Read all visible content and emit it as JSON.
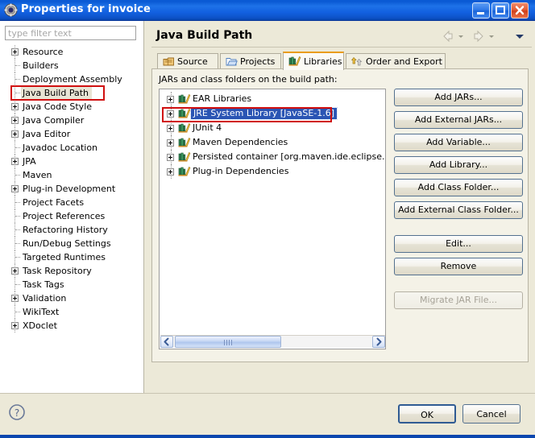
{
  "window": {
    "title": "Properties for invoice",
    "icon": "gear-icon",
    "controls": {
      "minimize": "Minimize",
      "maximize": "Maximize",
      "close": "Close"
    }
  },
  "colors": {
    "titlebar_blue": "#0a5ad4",
    "accent_orange": "#e99c1b",
    "selection_blue": "#2a55b4",
    "annotation_red": "#d01010",
    "dialog_bg": "#ece9d8",
    "group_bg": "#f4f2e7"
  },
  "sidebar": {
    "filter": {
      "value": "",
      "placeholder": "type filter text"
    },
    "items": [
      {
        "label": "Resource",
        "expandable": true
      },
      {
        "label": "Builders",
        "expandable": false
      },
      {
        "label": "Deployment Assembly",
        "expandable": false
      },
      {
        "label": "Java Build Path",
        "expandable": false,
        "selected": true,
        "annotated": true
      },
      {
        "label": "Java Code Style",
        "expandable": true
      },
      {
        "label": "Java Compiler",
        "expandable": true
      },
      {
        "label": "Java Editor",
        "expandable": true
      },
      {
        "label": "Javadoc Location",
        "expandable": false
      },
      {
        "label": "JPA",
        "expandable": true
      },
      {
        "label": "Maven",
        "expandable": false
      },
      {
        "label": "Plug-in Development",
        "expandable": true
      },
      {
        "label": "Project Facets",
        "expandable": false
      },
      {
        "label": "Project References",
        "expandable": false
      },
      {
        "label": "Refactoring History",
        "expandable": false
      },
      {
        "label": "Run/Debug Settings",
        "expandable": false
      },
      {
        "label": "Targeted Runtimes",
        "expandable": false
      },
      {
        "label": "Task Repository",
        "expandable": true
      },
      {
        "label": "Task Tags",
        "expandable": false
      },
      {
        "label": "Validation",
        "expandable": true
      },
      {
        "label": "WikiText",
        "expandable": false
      },
      {
        "label": "XDoclet",
        "expandable": true
      }
    ]
  },
  "page": {
    "title": "Java Build Path",
    "nav": {
      "back": "back-arrow-icon",
      "back_dropdown": "back-dropdown-caret",
      "forward": "forward-arrow-icon",
      "forward_dropdown": "forward-dropdown-caret",
      "menu": "view-menu-caret"
    },
    "tabs": [
      {
        "label": "Source",
        "icon": "package-icon",
        "active": false
      },
      {
        "label": "Projects",
        "icon": "folder-icon",
        "active": false
      },
      {
        "label": "Libraries",
        "icon": "library-books-icon",
        "active": true
      },
      {
        "label": "Order and Export",
        "icon": "order-arrows-icon",
        "active": false
      }
    ],
    "group_caption": "JARs and class folders on the build path:",
    "libraries": [
      {
        "label": "EAR Libraries",
        "icon": "library-books-icon",
        "expandable": true,
        "selected": false
      },
      {
        "label": "JRE System Library [JavaSE-1.6]",
        "icon": "library-books-icon",
        "expandable": true,
        "selected": true,
        "annotated": true
      },
      {
        "label": "JUnit 4",
        "icon": "library-books-icon",
        "expandable": true,
        "selected": false
      },
      {
        "label": "Maven Dependencies",
        "icon": "library-books-icon",
        "expandable": true,
        "selected": false
      },
      {
        "label": "Persisted container [org.maven.ide.eclipse.MAVEN",
        "icon": "library-books-icon",
        "expandable": true,
        "selected": false
      },
      {
        "label": "Plug-in Dependencies",
        "icon": "library-books-icon",
        "expandable": true,
        "selected": false
      }
    ],
    "scrollbar": {
      "left_arrow": "scroll-left-arrow-icon",
      "right_arrow": "scroll-right-arrow-icon",
      "thumb": "scroll-thumb"
    },
    "buttons": [
      {
        "label": "Add JARs...",
        "enabled": true
      },
      {
        "label": "Add External JARs...",
        "enabled": true
      },
      {
        "label": "Add Variable...",
        "enabled": true
      },
      {
        "label": "Add Library...",
        "enabled": true
      },
      {
        "label": "Add Class Folder...",
        "enabled": true
      },
      {
        "label": "Add External Class Folder...",
        "enabled": true
      },
      {
        "label": "Edit...",
        "enabled": true
      },
      {
        "label": "Remove",
        "enabled": true
      },
      {
        "label": "Migrate JAR File...",
        "enabled": false
      }
    ]
  },
  "footer": {
    "help": "help-question-icon",
    "ok": "OK",
    "cancel": "Cancel"
  }
}
